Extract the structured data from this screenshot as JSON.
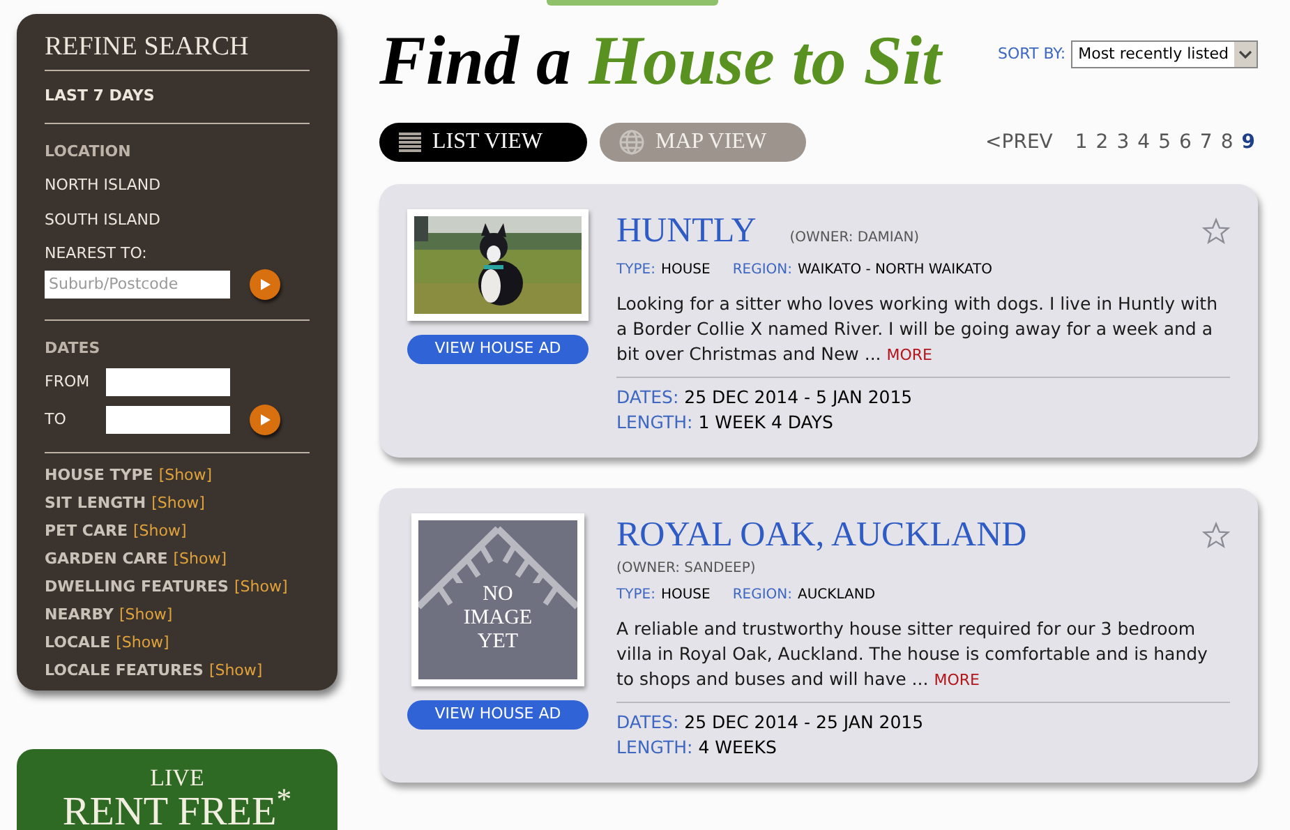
{
  "sidebar": {
    "title": "REFINE SEARCH",
    "recent": "LAST 7 DAYS",
    "location": {
      "heading": "LOCATION",
      "options": [
        "NORTH ISLAND",
        "SOUTH ISLAND"
      ],
      "nearest_label": "NEAREST TO:",
      "nearest_placeholder": "Suburb/Postcode"
    },
    "dates": {
      "heading": "DATES",
      "from_label": "FROM",
      "to_label": "TO"
    },
    "filters": [
      {
        "label": "HOUSE TYPE",
        "link": "[Show]"
      },
      {
        "label": "SIT LENGTH",
        "link": "[Show]"
      },
      {
        "label": "PET CARE",
        "link": "[Show]"
      },
      {
        "label": "GARDEN CARE",
        "link": "[Show]"
      },
      {
        "label": "DWELLING FEATURES",
        "link": "[Show]"
      },
      {
        "label": "NEARBY",
        "link": "[Show]"
      },
      {
        "label": "LOCALE",
        "link": "[Show]"
      },
      {
        "label": "LOCALE FEATURES",
        "link": "[Show]"
      }
    ]
  },
  "promo": {
    "line1": "LIVE",
    "line2": "RENT FREE$^{*}$"
  },
  "header": {
    "title_lead": "Find a",
    "title_rest": "House to Sit",
    "sort_label": "SORT BY:",
    "sort_value": "Most recently listed"
  },
  "views": [
    {
      "label": "LIST VIEW",
      "kind": "list",
      "selected": true
    },
    {
      "label": "MAP VIEW",
      "kind": "map",
      "selected": false
    }
  ],
  "pagination": {
    "prev": "<PREV",
    "pages": [
      {
        "label": "1",
        "selected": false
      },
      {
        "label": "2",
        "selected": false
      },
      {
        "label": "3",
        "selected": false
      },
      {
        "label": "4",
        "selected": false
      },
      {
        "label": "5",
        "selected": false
      },
      {
        "label": "6",
        "selected": false
      },
      {
        "label": "7",
        "selected": false
      },
      {
        "label": "8",
        "selected": false
      },
      {
        "label": "9",
        "selected": true
      }
    ]
  },
  "listings": [
    {
      "button": "VIEW HOUSE AD",
      "title": "HUNTLY",
      "owner": "(OWNER: DAMIAN)",
      "type_label": "TYPE:",
      "type": "HOUSE",
      "region_label": "REGION:",
      "region": "WAIKATO - NORTH WAIKATO",
      "description": "Looking for a sitter who loves working with dogs. I live in Huntly with a Border Collie X named River. I will be going away for a week and a bit over Christmas and New ...",
      "more": "MORE",
      "dates_label": "DATES:",
      "dates": "25 DEC 2014 - 5 JAN 2015",
      "length_label": "LENGTH:",
      "length": "1 WEEK 4 DAYS"
    },
    {
      "image": {
        "kind": "placeholder",
        "text": "NO IMAGE YET"
      },
      "button": "VIEW HOUSE AD",
      "title": "ROYAL OAK, AUCKLAND",
      "owner": "(OWNER: SANDEEP)",
      "type_label": "TYPE:",
      "type": "HOUSE",
      "region_label": "REGION:",
      "region": "AUCKLAND",
      "description": "A reliable and trustworthy house sitter required for our 3 bedroom villa in Royal Oak, Auckland. The house is comfortable and is handy to shops and buses and will have ...",
      "more": "MORE",
      "dates_label": "DATES:",
      "dates": "25 DEC 2014 - 25 JAN 2015",
      "length_label": "LENGTH:",
      "length": "4 WEEKS"
    }
  ]
}
